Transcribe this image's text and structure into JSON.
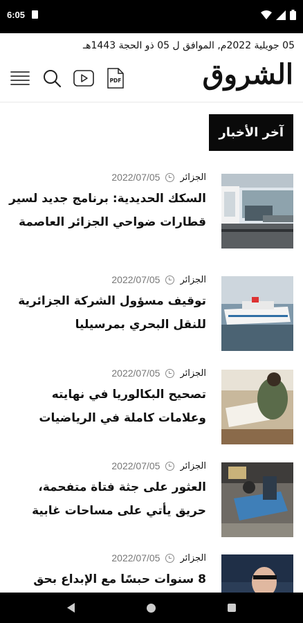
{
  "status_bar": {
    "time": "6:05"
  },
  "date_line": "05 جويلية 2022م, الموافق ل 05 ذو الحجة 1443هـ",
  "header": {
    "logo": "الشروق",
    "icons": [
      "menu-icon",
      "search-icon",
      "video-icon",
      "pdf-icon"
    ],
    "pdf_label": "PDF"
  },
  "section": {
    "title": "آخر الأخبار"
  },
  "articles": [
    {
      "category": "الجزائر",
      "date": "2022/07/05",
      "title": "السكك الحديدية: برنامج جديد لسير قطارات ضواحي الجزائر العاصمة",
      "thumb": "train-station"
    },
    {
      "category": "الجزائر",
      "date": "2022/07/05",
      "title": "توقيف مسؤول الشركة الجزائرية للنقل البحري بمرسيليا",
      "thumb": "ferry-ship"
    },
    {
      "category": "الجزائر",
      "date": "2022/07/05",
      "title": "تصحيح البكالوريا في نهايته وعلامات كاملة في الرياضيات",
      "thumb": "exam-correction"
    },
    {
      "category": "الجزائر",
      "date": "2022/07/05",
      "title": "العثور على جثة فتاة متفحمة، حريق يأتي على مساحات غابية",
      "thumb": "rescue-scene"
    },
    {
      "category": "الجزائر",
      "date": "2022/07/05",
      "title": "8 سنوات حبسًا مع الإبداع بحق",
      "thumb": "man-portrait"
    }
  ],
  "colors": {
    "accent": "#0a0a0a",
    "muted": "#777777"
  }
}
